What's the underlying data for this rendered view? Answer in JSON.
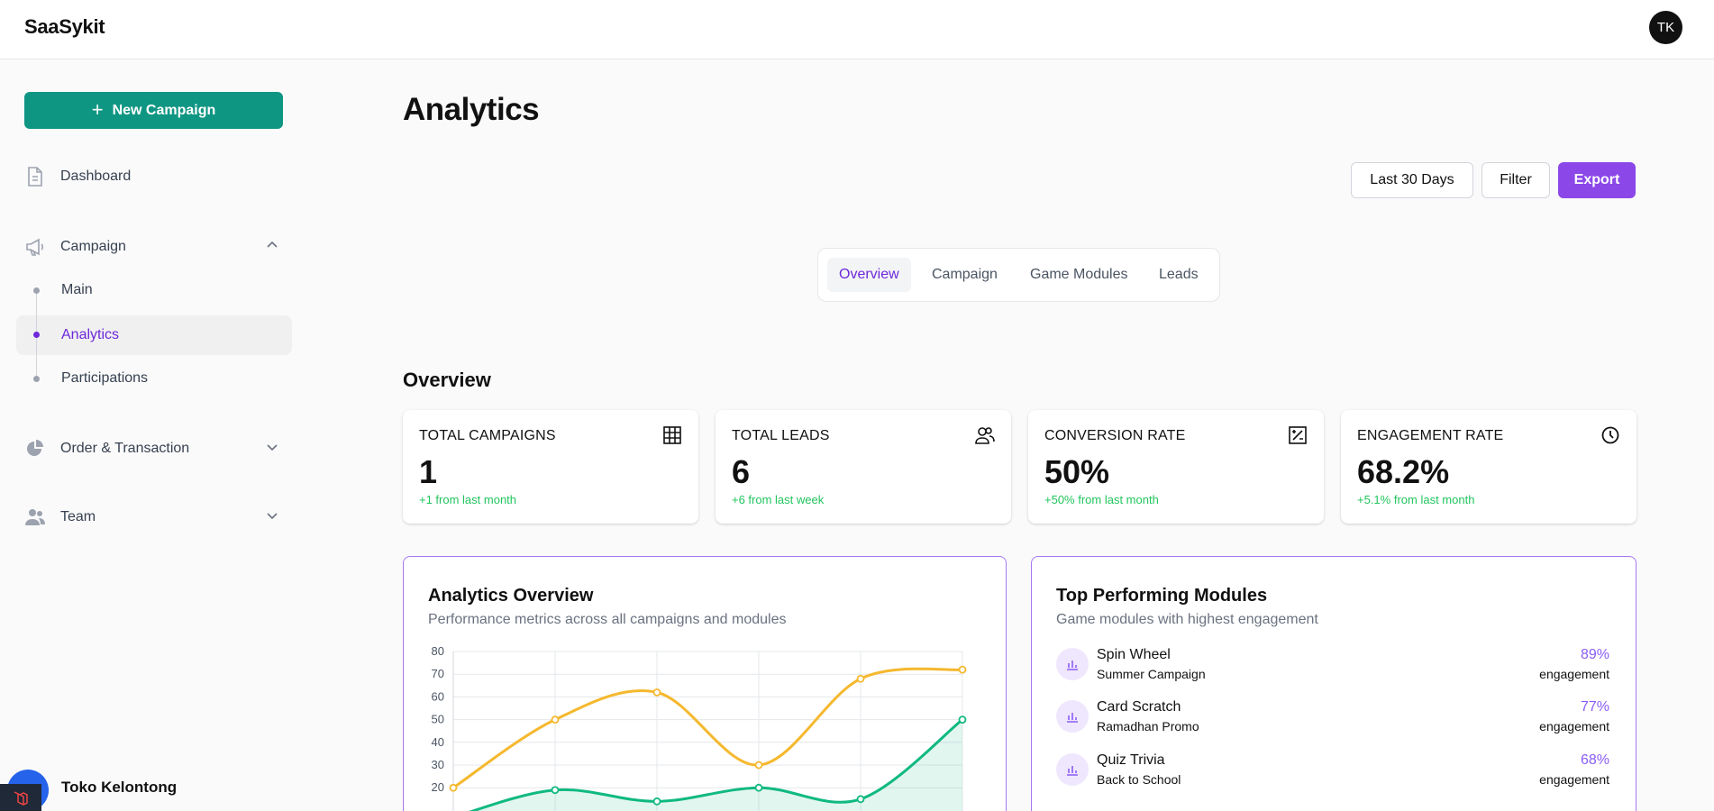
{
  "app": {
    "brand": "SaaSykit",
    "user_initials": "TK"
  },
  "sidebar": {
    "new_campaign_label": "New Campaign",
    "dashboard_label": "Dashboard",
    "campaign_label": "Campaign",
    "campaign_sub": [
      "Main",
      "Analytics",
      "Participations"
    ],
    "order_label": "Order & Transaction",
    "team_label": "Team",
    "account_name": "Toko Kelontong",
    "account_initials": "TK"
  },
  "header": {
    "title": "Analytics",
    "range_label": "Last 30 Days",
    "filter_label": "Filter",
    "export_label": "Export"
  },
  "tabs": [
    "Overview",
    "Campaign",
    "Game Modules",
    "Leads"
  ],
  "overview": {
    "title": "Overview",
    "stats": [
      {
        "label": "TOTAL CAMPAIGNS",
        "value": "1",
        "delta": "+1 from last month",
        "icon": "grid-icon"
      },
      {
        "label": "TOTAL LEADS",
        "value": "6",
        "delta": "+6 from last week",
        "icon": "users-icon"
      },
      {
        "label": "CONVERSION RATE",
        "value": "50%",
        "delta": "+50% from last month",
        "icon": "percent-square-icon"
      },
      {
        "label": "ENGAGEMENT RATE",
        "value": "68.2%",
        "delta": "+5.1% from last month",
        "icon": "clock-icon"
      }
    ]
  },
  "analytics_panel": {
    "title": "Analytics Overview",
    "subtitle": "Performance metrics across all campaigns and modules"
  },
  "modules_panel": {
    "title": "Top Performing Modules",
    "subtitle": "Game modules with highest engagement",
    "items": [
      {
        "name": "Spin Wheel",
        "campaign": "Summer Campaign",
        "pct": "89%",
        "unit": "engagement"
      },
      {
        "name": "Card Scratch",
        "campaign": "Ramadhan Promo",
        "pct": "77%",
        "unit": "engagement"
      },
      {
        "name": "Quiz Trivia",
        "campaign": "Back to School",
        "pct": "68%",
        "unit": "engagement"
      }
    ]
  },
  "colors": {
    "accent": "#8b47e8",
    "primary": "#0f9683",
    "positive": "#22c55e",
    "series_a": "#f5b82e",
    "series_b": "#10b981"
  },
  "chart_data": {
    "type": "line",
    "y_ticks": [
      "80",
      "70",
      "60",
      "50",
      "40",
      "30",
      "20"
    ],
    "ylim": [
      10,
      80
    ],
    "grid": true,
    "series": [
      {
        "values": [
          20,
          50,
          62,
          30,
          68,
          72
        ]
      },
      {
        "values": [
          7,
          19,
          14,
          20,
          15,
          50
        ]
      }
    ]
  }
}
